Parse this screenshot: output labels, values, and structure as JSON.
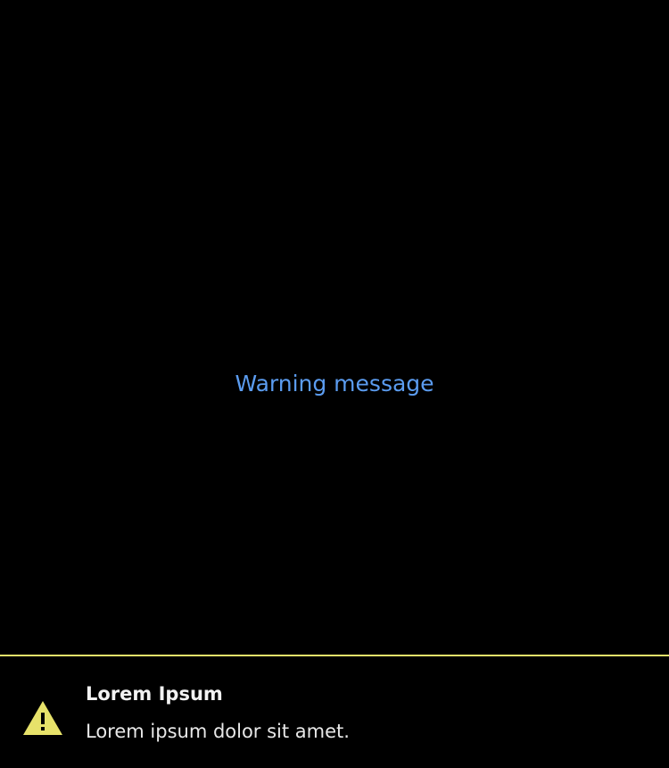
{
  "main": {
    "trigger_label": "Warning message"
  },
  "toast": {
    "title": "Lorem Ipsum",
    "body": "Lorem ipsum dolor sit amet.",
    "icon": "warning-triangle-icon",
    "status": "warning"
  },
  "colors": {
    "background": "#000000",
    "link": "#5b9cf0",
    "warning": "#e7e26a",
    "text": "#f2f2f2"
  }
}
